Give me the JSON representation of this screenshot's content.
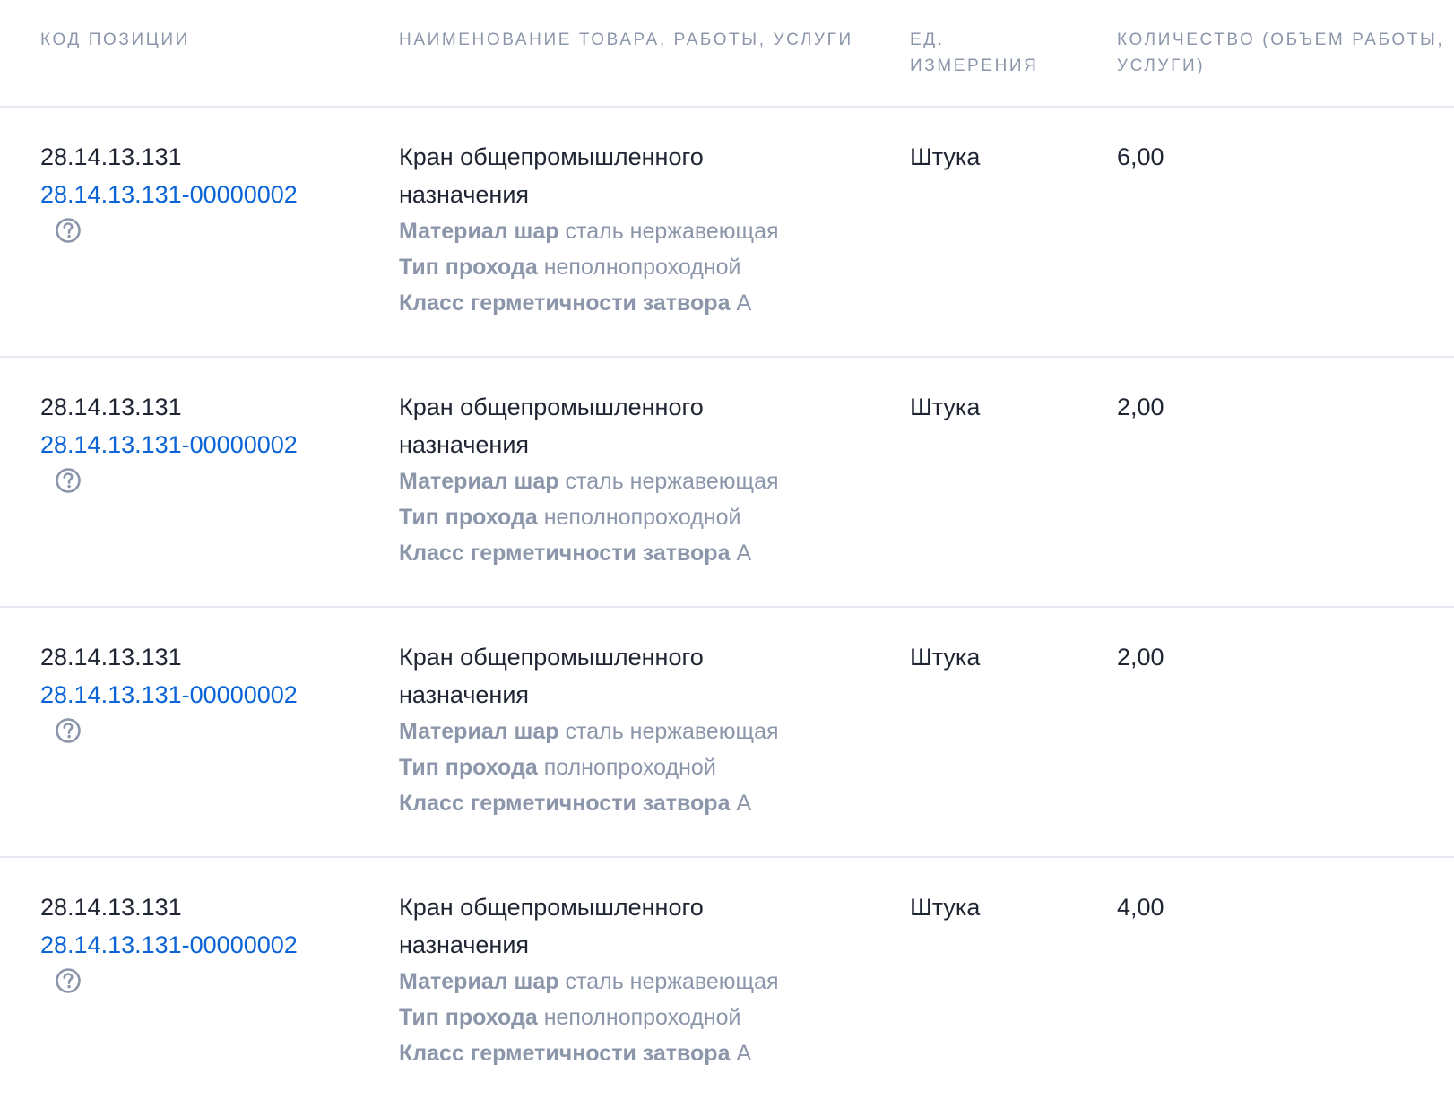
{
  "header": {
    "code": "КОД ПОЗИЦИИ",
    "name": "НАИМЕНОВАНИЕ ТОВАРА, РАБОТЫ, УСЛУГИ",
    "unit_line1": "ЕД.",
    "unit_line2": "ИЗМЕРЕНИЯ",
    "qty_line1": "КОЛИЧЕСТВО (ОБЪЕМ РАБОТЫ,",
    "qty_line2": "УСЛУГИ)"
  },
  "rows": [
    {
      "okpd": "28.14.13.131",
      "ktru": "28.14.13.131-00000002",
      "help_icon": "question-circle-icon",
      "name_line1": "Кран общепромышленного",
      "name_line2": "назначения",
      "attrs": [
        {
          "label": "Материал шар",
          "value": "сталь нержавеющая"
        },
        {
          "label": "Тип прохода",
          "value": "неполнопроходной"
        },
        {
          "label": "Класс герметичности затвора",
          "value": "А"
        }
      ],
      "unit": "Штука",
      "qty": "6,00"
    },
    {
      "okpd": "28.14.13.131",
      "ktru": "28.14.13.131-00000002",
      "help_icon": "question-circle-icon",
      "name_line1": "Кран общепромышленного",
      "name_line2": "назначения",
      "attrs": [
        {
          "label": "Материал шар",
          "value": "сталь нержавеющая"
        },
        {
          "label": "Тип прохода",
          "value": "неполнопроходной"
        },
        {
          "label": "Класс герметичности затвора",
          "value": "А"
        }
      ],
      "unit": "Штука",
      "qty": "2,00"
    },
    {
      "okpd": "28.14.13.131",
      "ktru": "28.14.13.131-00000002",
      "help_icon": "question-circle-icon",
      "name_line1": "Кран общепромышленного",
      "name_line2": "назначения",
      "attrs": [
        {
          "label": "Материал шар",
          "value": "сталь нержавеющая"
        },
        {
          "label": "Тип прохода",
          "value": "полнопроходной"
        },
        {
          "label": "Класс герметичности затвора",
          "value": "А"
        }
      ],
      "unit": "Штука",
      "qty": "2,00"
    },
    {
      "okpd": "28.14.13.131",
      "ktru": "28.14.13.131-00000002",
      "help_icon": "question-circle-icon",
      "name_line1": "Кран общепромышленного",
      "name_line2": "назначения",
      "attrs": [
        {
          "label": "Материал шар",
          "value": "сталь нержавеющая"
        },
        {
          "label": "Тип прохода",
          "value": "неполнопроходной"
        },
        {
          "label": "Класс герметичности затвора",
          "value": "А"
        }
      ],
      "unit": "Штука",
      "qty": "4,00"
    }
  ],
  "colors": {
    "text": "#1f2533",
    "muted": "#8c96aa",
    "link": "#0a64d6",
    "divider": "#e4e8ef"
  }
}
